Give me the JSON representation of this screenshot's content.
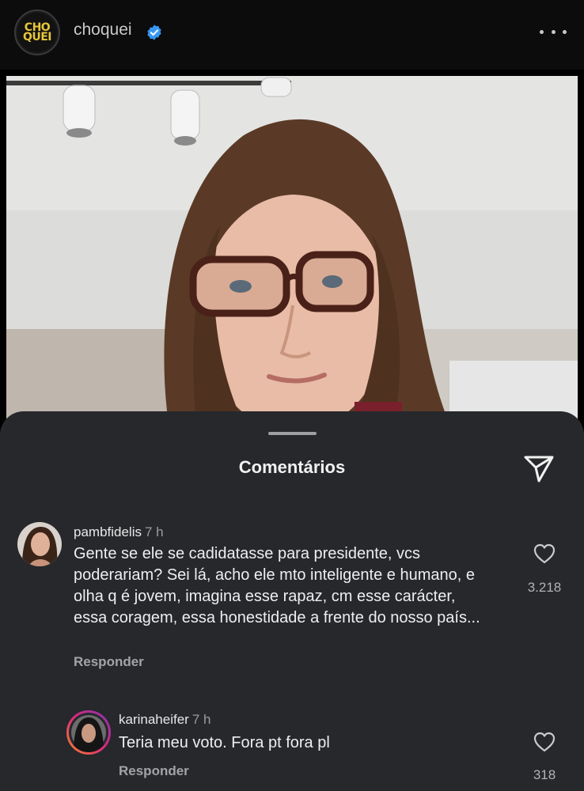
{
  "header": {
    "logo_line1": "CHO",
    "logo_line2": "QUEI",
    "account_name": "choquei"
  },
  "post": {
    "image_description": "selfie"
  },
  "comments_sheet": {
    "title": "Comentários",
    "comments": [
      {
        "username": "pambfidelis",
        "time": "7 h",
        "text": "Gente se ele se cadidatasse para presidente, vcs poderariam? Sei lá, acho ele mto inteligente e humano, e olha q é jovem, imagina esse rapaz, cm esse carácter, essa coragem, essa honestidade a frente do nosso país...",
        "reply_label": "Responder",
        "likes": "3.218"
      },
      {
        "username": "karinaheifer",
        "time": "7 h",
        "text": "Teria meu voto. Fora pt fora pl",
        "reply_label": "Responder",
        "likes": "318"
      }
    ]
  },
  "colors": {
    "sheet_bg": "#26282c",
    "verified_blue": "#3897f0",
    "logo_yellow": "#e7c63a",
    "story_ring_start": "#f58529",
    "story_ring_end": "#dd2a7b"
  },
  "icons": [
    "verified-badge-icon",
    "more-options-icon",
    "share-send-icon",
    "heart-icon"
  ]
}
